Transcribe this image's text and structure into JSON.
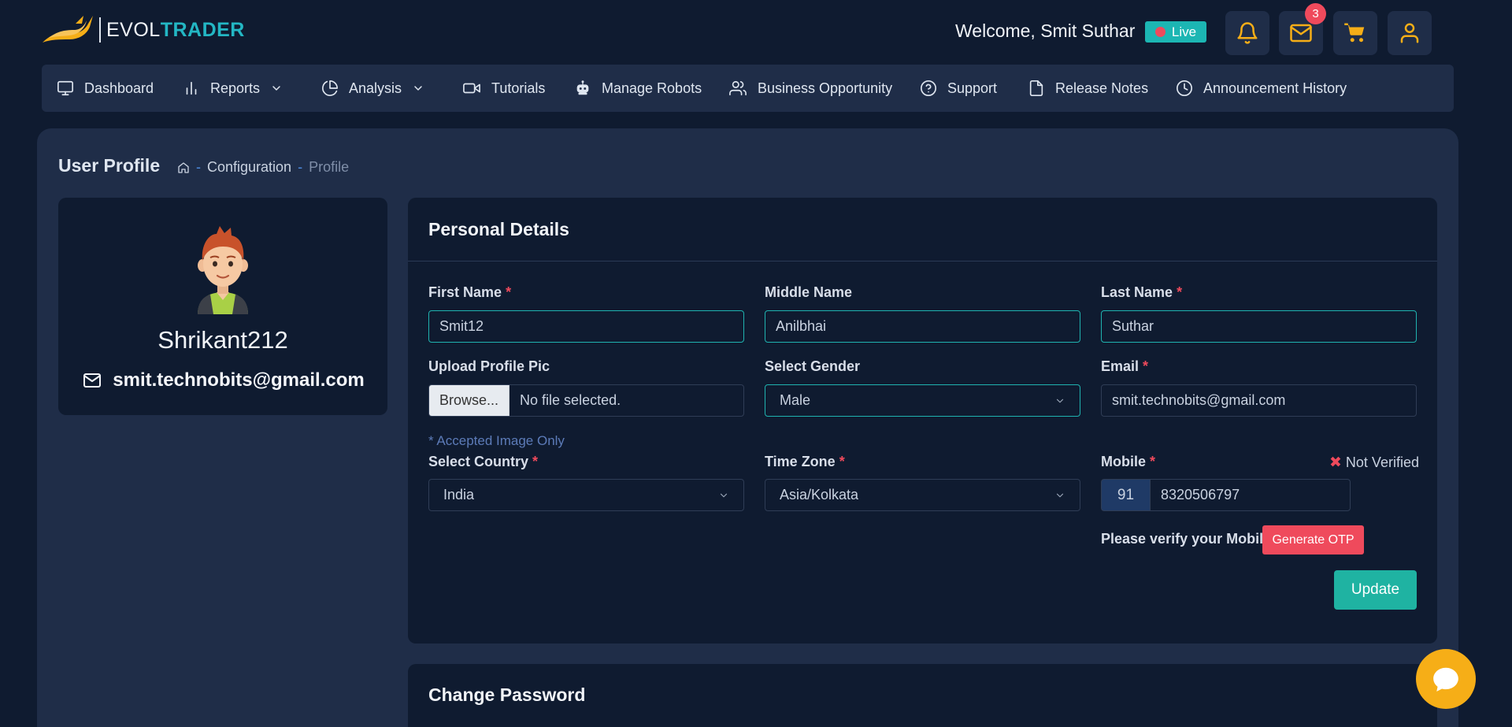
{
  "header": {
    "logo": {
      "text_plain": "EVOL",
      "text_accent": "TRADER",
      "icon": "bull-logo-icon"
    },
    "welcome": "Welcome, Smit Suthar",
    "live_badge": "Live",
    "mail_count": "3",
    "icons": [
      "bell-icon",
      "mail-icon",
      "cart-icon",
      "user-icon"
    ]
  },
  "nav": {
    "items": [
      {
        "label": "Dashboard",
        "icon": "monitor-icon"
      },
      {
        "label": "Reports",
        "icon": "bar-chart-icon",
        "dropdown": true
      },
      {
        "label": "Analysis",
        "icon": "pie-chart-icon",
        "dropdown": true
      },
      {
        "label": "Tutorials",
        "icon": "video-icon"
      },
      {
        "label": "Manage Robots",
        "icon": "robot-icon"
      },
      {
        "label": "Business Opportunity",
        "icon": "users-icon"
      },
      {
        "label": "Support",
        "icon": "help-circle-icon"
      },
      {
        "label": "Release Notes",
        "icon": "file-icon"
      },
      {
        "label": "Announcement History",
        "icon": "clock-icon"
      }
    ]
  },
  "page": {
    "title": "User Profile",
    "breadcrumb": {
      "sep": "-",
      "parent": "Configuration",
      "current": "Profile"
    }
  },
  "profile_card": {
    "username": "Shrikant212",
    "email": "smit.technobits@gmail.com"
  },
  "personal_details": {
    "title": "Personal Details",
    "required_mark": "*",
    "first_name": {
      "label": "First Name",
      "value": "Smit12"
    },
    "middle_name": {
      "label": "Middle Name",
      "value": "Anilbhai"
    },
    "last_name": {
      "label": "Last Name",
      "value": "Suthar"
    },
    "upload": {
      "label": "Upload Profile Pic",
      "button": "Browse...",
      "status": "No file selected.",
      "hint": "* Accepted Image Only"
    },
    "gender": {
      "label": "Select Gender",
      "value": "Male"
    },
    "email": {
      "label": "Email",
      "value": "smit.technobits@gmail.com"
    },
    "country": {
      "label": "Select Country",
      "value": "India"
    },
    "timezone": {
      "label": "Time Zone",
      "value": "Asia/Kolkata"
    },
    "mobile": {
      "label": "Mobile",
      "code": "91",
      "value": "8320506797",
      "status_mark": "✖",
      "status": "Not Verified"
    },
    "verify_text": "Please verify your Mobile",
    "otp_button": "Generate OTP",
    "update_button": "Update"
  },
  "change_password": {
    "title": "Change Password"
  },
  "colors": {
    "bg": "#0f1b30",
    "panel": "#1f2d48",
    "accent": "#1fb3b0",
    "danger": "#ef4a5c",
    "warning": "#f6ae17"
  }
}
